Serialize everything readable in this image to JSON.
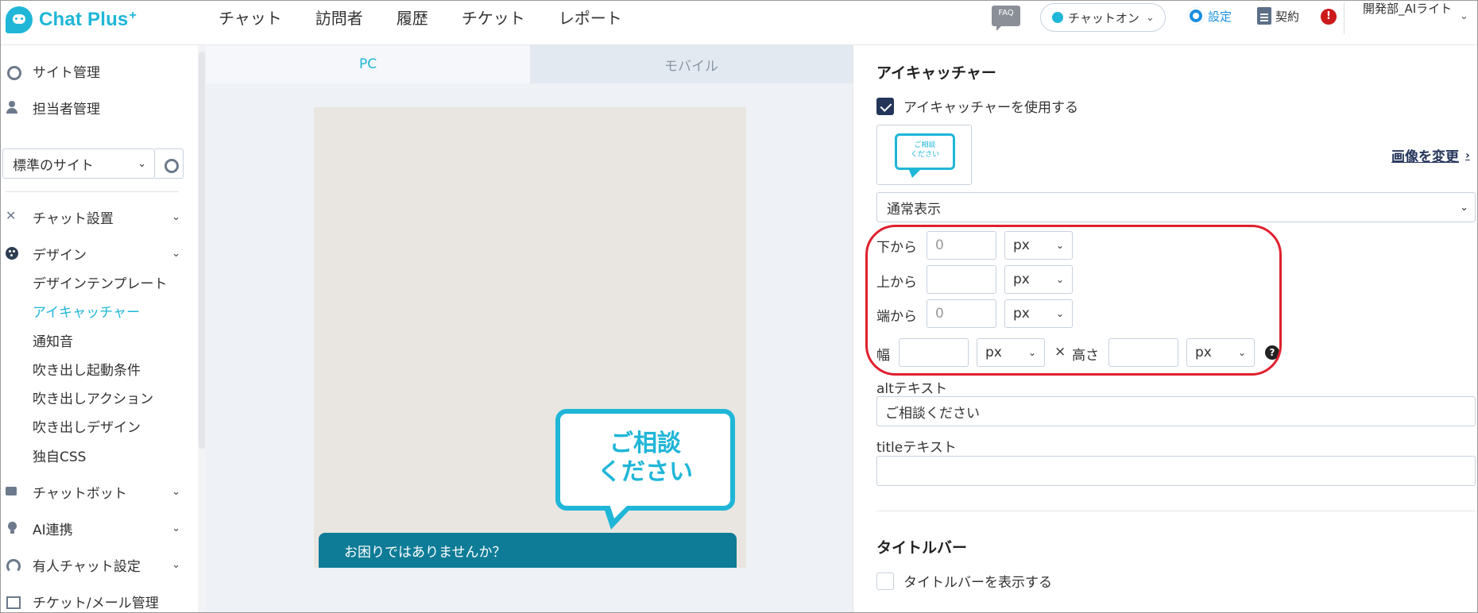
{
  "header": {
    "logo": "Chat Plus",
    "logo_plus": "+",
    "nav": [
      "チャット",
      "訪問者",
      "履歴",
      "チケット",
      "レポート"
    ],
    "faq": "FAQ",
    "chat_status": "チャットオン",
    "settings": "設定",
    "contract": "契約",
    "alert": "!",
    "user": "開発部_AIライト"
  },
  "sidebar": {
    "site_admin": "サイト管理",
    "staff_admin": "担当者管理",
    "site_select": "標準のサイト",
    "chat_setup": "チャット設置",
    "design": "デザイン",
    "design_items": [
      "デザインテンプレート",
      "アイキャッチャー",
      "通知音",
      "吹き出し起動条件",
      "吹き出しアクション",
      "吹き出しデザイン",
      "独自CSS"
    ],
    "chatbot": "チャットボット",
    "ai": "AI連携",
    "manned_chat": "有人チャット設定",
    "ticket_mail": "チケット/メール管理"
  },
  "preview": {
    "tab_pc": "PC",
    "tab_mobile": "モバイル",
    "eyecatch_line1": "ご相談",
    "eyecatch_line2": "ください",
    "chatbar_text": "お困りではありませんか？"
  },
  "panel": {
    "eyecatcher_title": "アイキャッチャー",
    "use_eyecatcher": "アイキャッチャーを使用する",
    "use_eyecatcher_checked": true,
    "thumb_text1": "ご相談",
    "thumb_text2": "ください",
    "change_image": "画像を変更",
    "display_mode": "通常表示",
    "from_bottom_label": "下から",
    "from_bottom_value": "0",
    "from_bottom_unit": "px",
    "from_top_label": "上から",
    "from_top_value": "",
    "from_top_unit": "px",
    "from_edge_label": "端から",
    "from_edge_value": "0",
    "from_edge_unit": "px",
    "width_label": "幅",
    "width_value": "",
    "width_unit": "px",
    "times": "×",
    "height_label": "高さ",
    "height_value": "",
    "height_unit": "px",
    "help": "?",
    "alt_label": "altテキスト",
    "alt_value": "ご相談ください",
    "title_label": "titleテキスト",
    "title_value": "",
    "titlebar_title": "タイトルバー",
    "show_titlebar": "タイトルバーを表示する",
    "show_titlebar_checked": false
  },
  "colors": {
    "brand": "#1fb6d8",
    "checkbox_checked": "#24355a",
    "chatbar": "#0e7c96",
    "highlight": "#e0202e"
  }
}
